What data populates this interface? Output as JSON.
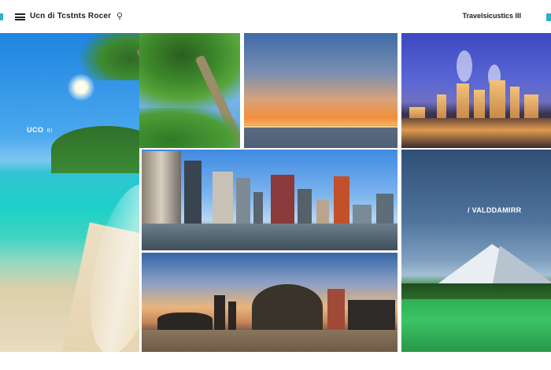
{
  "header": {
    "brand": "Ucn di Tcstnts Rocer",
    "nav_right": "Travelsicustics III",
    "brand_icon": "camera-icon",
    "menu_icon": "hamburger-icon"
  },
  "tiles": {
    "beach": {
      "label": "UCO",
      "sublabel": "BI"
    },
    "mountain": {
      "label": "/ VALDDAMIRR"
    }
  },
  "colors": {
    "accent": "#2ab0c8",
    "header_text": "#1d1d1d"
  }
}
